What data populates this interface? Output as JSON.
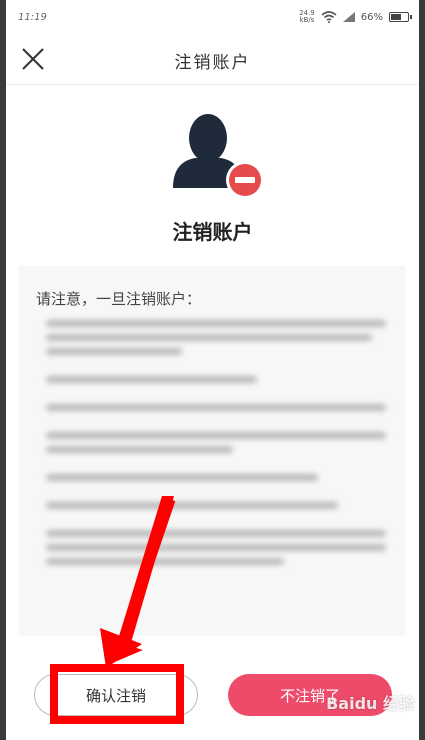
{
  "status": {
    "time": "11:19",
    "speed_value": "24.9",
    "speed_unit": "kB/s",
    "battery": "66%",
    "battery_level": 0.66
  },
  "header": {
    "title": "注销账户"
  },
  "main": {
    "title": "注销账户",
    "notice_title": "请注意，一旦注销账户："
  },
  "actions": {
    "confirm_label": "确认注销",
    "cancel_label": "不注销了"
  },
  "watermark": "Baidu 经验",
  "colors": {
    "accent": "#ee4a6a",
    "highlight": "#ff0000",
    "avatar": "#1f2a3a",
    "badge": "#e64b4b"
  }
}
